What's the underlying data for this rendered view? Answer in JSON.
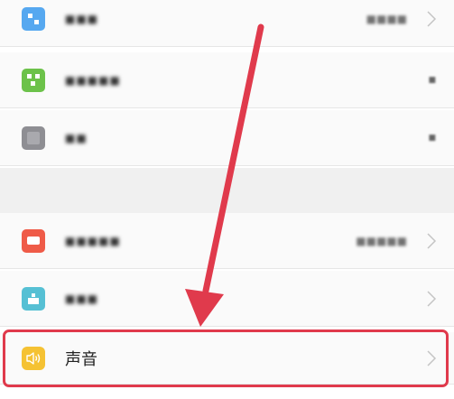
{
  "settings": {
    "rows": [
      {
        "label": "■■■",
        "value": "■■■■",
        "icon": "blue-grid-icon",
        "icon_color": "#56a8f0",
        "chevron": true
      },
      {
        "label": "■■■■■",
        "value": "",
        "icon": "green-grid-icon",
        "icon_color": "#6cc24a",
        "chevron": false
      },
      {
        "label": "■■",
        "value": "",
        "icon": "grey-square-icon",
        "icon_color": "#8e8e93",
        "chevron": false
      },
      {
        "label": "■■■■■",
        "value": "■■■■■",
        "icon": "red-message-icon",
        "icon_color": "#ef5b48",
        "chevron": true
      },
      {
        "label": "■■■",
        "value": "",
        "icon": "teal-app-icon",
        "icon_color": "#56c0d4",
        "chevron": true
      },
      {
        "label": "声音",
        "value": "",
        "icon": "speaker-icon",
        "icon_color": "#f5c233",
        "chevron": true
      }
    ]
  },
  "annotation": {
    "arrow_color": "#e03a4c",
    "highlight_color": "#e03a4c"
  }
}
